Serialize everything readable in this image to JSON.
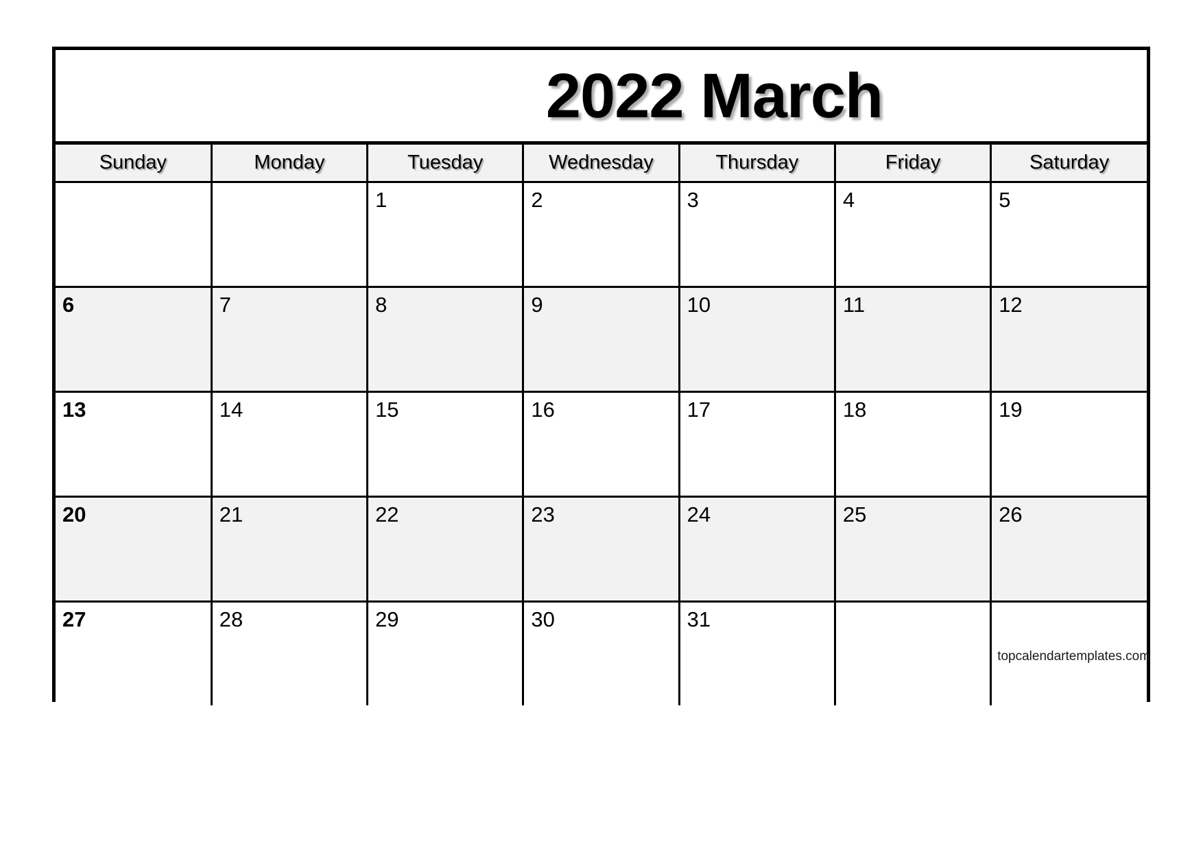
{
  "page": {
    "background_color": "#ffffff"
  },
  "calendar": {
    "title": "2022 March",
    "year": "2022",
    "month": "March",
    "border_color": "#000000",
    "shaded_row_color": "#f2f2f2",
    "header_row_color": "#f2f2f2",
    "weekday_headers": [
      "Sunday",
      "Monday",
      "Tuesday",
      "Wednesday",
      "Thursday",
      "Friday",
      "Saturday"
    ],
    "weeks": [
      {
        "shaded": false,
        "days": [
          "",
          "",
          "1",
          "2",
          "3",
          "4",
          "5"
        ]
      },
      {
        "shaded": true,
        "days": [
          "6",
          "7",
          "8",
          "9",
          "10",
          "11",
          "12"
        ]
      },
      {
        "shaded": false,
        "days": [
          "13",
          "14",
          "15",
          "16",
          "17",
          "18",
          "19"
        ]
      },
      {
        "shaded": true,
        "days": [
          "20",
          "21",
          "22",
          "23",
          "24",
          "25",
          "26"
        ]
      },
      {
        "shaded": false,
        "days": [
          "27",
          "28",
          "29",
          "30",
          "31",
          "",
          ""
        ]
      }
    ],
    "watermark": "topcalendartemplates.com"
  }
}
